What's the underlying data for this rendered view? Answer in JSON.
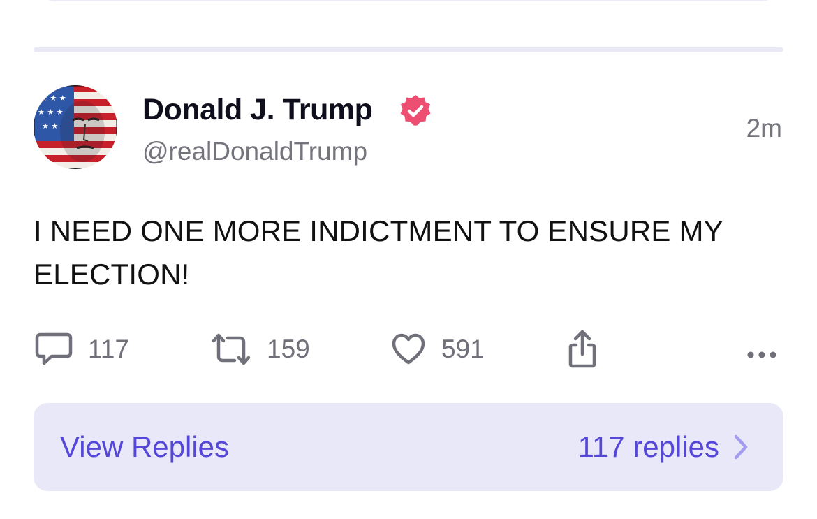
{
  "post": {
    "author_name": "Donald J. Trump",
    "author_handle": "@realDonaldTrump",
    "timestamp": "2m",
    "text": "I NEED ONE MORE INDICTMENT TO ENSURE MY ELECTION!",
    "verified": true
  },
  "actions": {
    "reply_icon": "speech-bubble-icon",
    "reply_count": "117",
    "repost_icon": "repost-arrows-icon",
    "repost_count": "159",
    "like_icon": "heart-icon",
    "like_count": "591",
    "share_icon": "share-icon",
    "more_icon": "ellipsis-icon"
  },
  "replies_bar": {
    "label": "View Replies",
    "count_label": "117 replies",
    "chevron_icon": "chevron-right-icon"
  },
  "colors": {
    "accent": "#5548d9",
    "verified_badge": "#ec4f72",
    "replies_bar_bg": "#e9e8f8",
    "divider": "#e9e8f7",
    "muted_text": "#74747d"
  }
}
